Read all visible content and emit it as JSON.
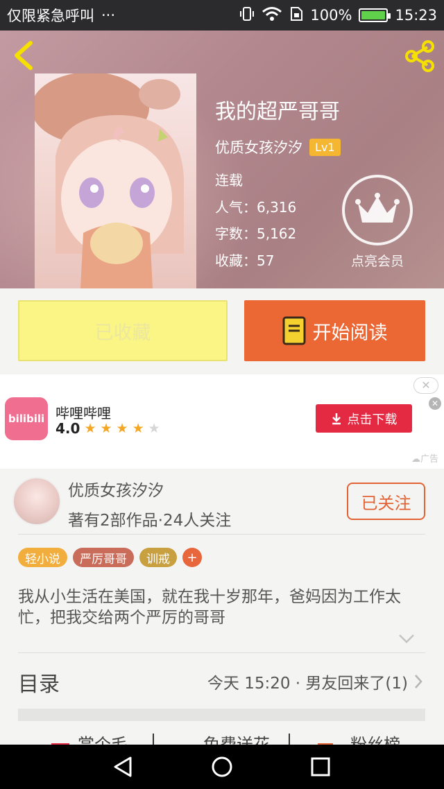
{
  "status_bar": {
    "left_text": "仅限紧急呼叫",
    "more": "···",
    "battery_percent": "100%",
    "battery_level": 1.0,
    "time": "15:23"
  },
  "header": {
    "back_icon": "chevron-left-icon",
    "share_icon": "share-icon"
  },
  "book": {
    "title": "我的超严哥哥",
    "author": "优质女孩汐汐",
    "level": "Lv1",
    "status": "连载",
    "popularity": "人气：6,316",
    "word_count": "字数：5,162",
    "favorites": "收藏：57"
  },
  "vip": {
    "icon": "crown-icon",
    "label": "点亮会员"
  },
  "actions": {
    "collected_label": "已收藏",
    "read_label": "开始阅读",
    "read_icon": "book-icon"
  },
  "ad": {
    "app_name": "哔哩哔哩",
    "logo_text": "bilibili",
    "rating": "4.0",
    "rating_value": 4.0,
    "download_label": "点击下载",
    "ad_tag": "广告"
  },
  "author_card": {
    "name": "优质女孩汐汐",
    "stats": "著有2部作品·24人关注",
    "follow_label": "已关注"
  },
  "tags": [
    {
      "label": "轻小说",
      "color": "#f2ae3d"
    },
    {
      "label": "严厉哥哥",
      "color": "#c96c5a"
    },
    {
      "label": "训戒",
      "color": "#c9a03f"
    }
  ],
  "summary": "我从小生活在美国，就在我十岁那年，爸妈因为工作太忙，把我交给两个严厉的哥哥",
  "catalog": {
    "title": "目录",
    "latest": "今天 15:20 · 男友回来了(1)"
  },
  "bottom_tabs": [
    {
      "label": "赏个毛"
    },
    {
      "label": "免费送花"
    },
    {
      "label": "粉丝榜"
    }
  ],
  "colors": {
    "accent_orange": "#eb6734",
    "collected_yellow": "#fbf585",
    "bilibili_pink": "#f06e8f",
    "download_red": "#e32a42"
  }
}
